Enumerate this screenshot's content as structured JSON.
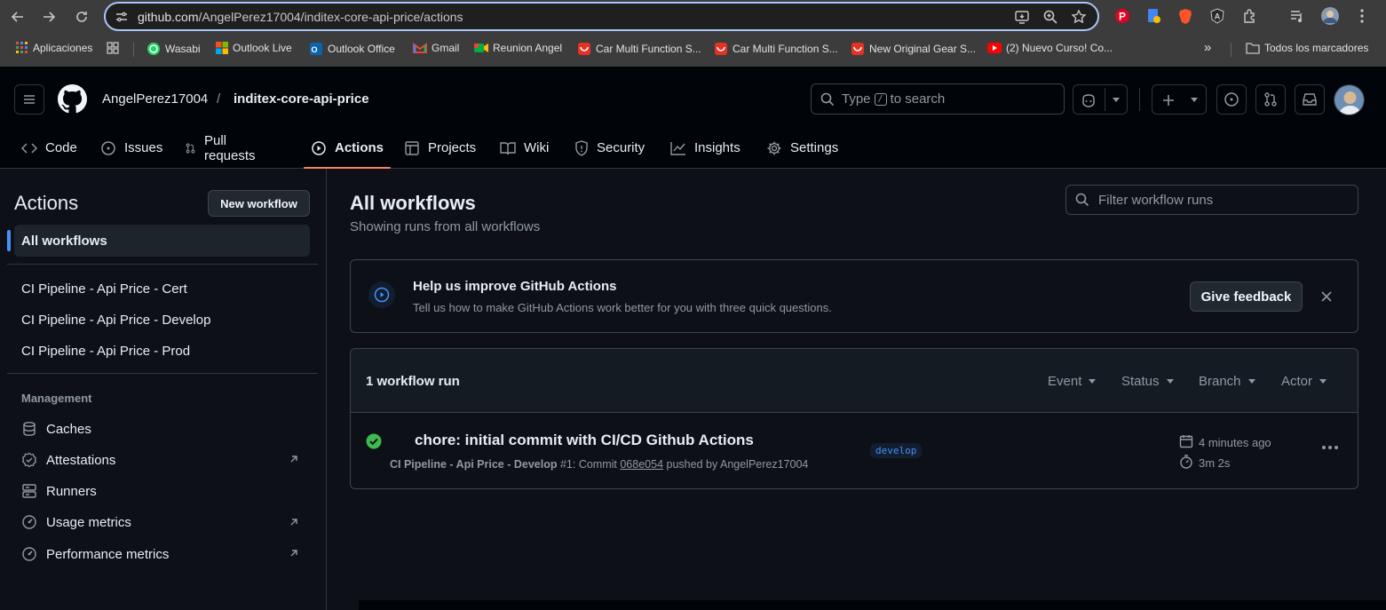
{
  "browser": {
    "url_host": "github.com",
    "url_path": "/AngelPerez17004/inditex-core-api-price/actions",
    "bookmarks": [
      {
        "label": "Aplicaciones",
        "icon": "apps-grid-icon",
        "color": "#e8453c"
      },
      {
        "label": "",
        "icon": "grid-icon",
        "color": "#c7c7c7"
      },
      {
        "label": "Wasabi",
        "icon": "whatsapp-icon",
        "color": "#25d366"
      },
      {
        "label": "Outlook Live",
        "icon": "microsoft-icon",
        "color": "#f25022"
      },
      {
        "label": "Outlook Office",
        "icon": "outlook-icon",
        "color": "#0a64ad"
      },
      {
        "label": "Gmail",
        "icon": "gmail-icon",
        "color": "#ea4335"
      },
      {
        "label": "Reunion Angel",
        "icon": "meet-icon",
        "color": "#00ac47"
      },
      {
        "label": "Car Multi Function S...",
        "icon": "aliexpress-icon",
        "color": "#e43225"
      },
      {
        "label": "Car Multi Function S...",
        "icon": "aliexpress-icon",
        "color": "#e43225"
      },
      {
        "label": "New Original Gear S...",
        "icon": "aliexpress-icon",
        "color": "#e43225"
      },
      {
        "label": "(2) Nuevo Curso! Co...",
        "icon": "youtube-icon",
        "color": "#ff0000"
      }
    ],
    "overflow": "»",
    "all_bookmarks": "Todos los marcadores"
  },
  "header": {
    "owner": "AngelPerez17004",
    "separator": "/",
    "repo": "inditex-core-api-price",
    "search_type": "Type",
    "search_key": "/",
    "search_rest": "to search"
  },
  "tabs": [
    {
      "label": "Code",
      "icon": "code-icon"
    },
    {
      "label": "Issues",
      "icon": "issue-icon"
    },
    {
      "label": "Pull requests",
      "icon": "pull-request-icon"
    },
    {
      "label": "Actions",
      "icon": "play-icon",
      "active": true
    },
    {
      "label": "Projects",
      "icon": "table-icon"
    },
    {
      "label": "Wiki",
      "icon": "book-icon"
    },
    {
      "label": "Security",
      "icon": "shield-icon"
    },
    {
      "label": "Insights",
      "icon": "graph-icon"
    },
    {
      "label": "Settings",
      "icon": "gear-icon"
    }
  ],
  "sidebar": {
    "title": "Actions",
    "new_workflow": "New workflow",
    "all_workflows": "All workflows",
    "workflows": [
      "CI Pipeline - Api Price - Cert",
      "CI Pipeline - Api Price - Develop",
      "CI Pipeline - Api Price - Prod"
    ],
    "management_heading": "Management",
    "management": [
      {
        "label": "Caches",
        "icon": "database-icon",
        "external": false
      },
      {
        "label": "Attestations",
        "icon": "verified-icon",
        "external": true
      },
      {
        "label": "Runners",
        "icon": "server-icon",
        "external": false
      },
      {
        "label": "Usage metrics",
        "icon": "meter-icon",
        "external": true
      },
      {
        "label": "Performance metrics",
        "icon": "meter-icon",
        "external": true
      }
    ]
  },
  "main": {
    "title": "All workflows",
    "subtitle": "Showing runs from all workflows",
    "filter_placeholder": "Filter workflow runs",
    "banner": {
      "title": "Help us improve GitHub Actions",
      "text": "Tell us how to make GitHub Actions work better for you with three quick questions.",
      "button": "Give feedback"
    },
    "runs": {
      "count_label": "1 workflow run",
      "filters": [
        "Event",
        "Status",
        "Branch",
        "Actor"
      ],
      "items": [
        {
          "title": "chore: initial commit with CI/CD Github Actions",
          "workflow": "CI Pipeline - Api Price - Develop",
          "run_number": "#1",
          "commit_prefix": ": Commit",
          "commit": "068e054",
          "pushed_by": "pushed by AngelPerez17004",
          "branch": "develop",
          "time_ago": "4 minutes ago",
          "duration": "3m 2s",
          "status": "success"
        }
      ]
    }
  }
}
